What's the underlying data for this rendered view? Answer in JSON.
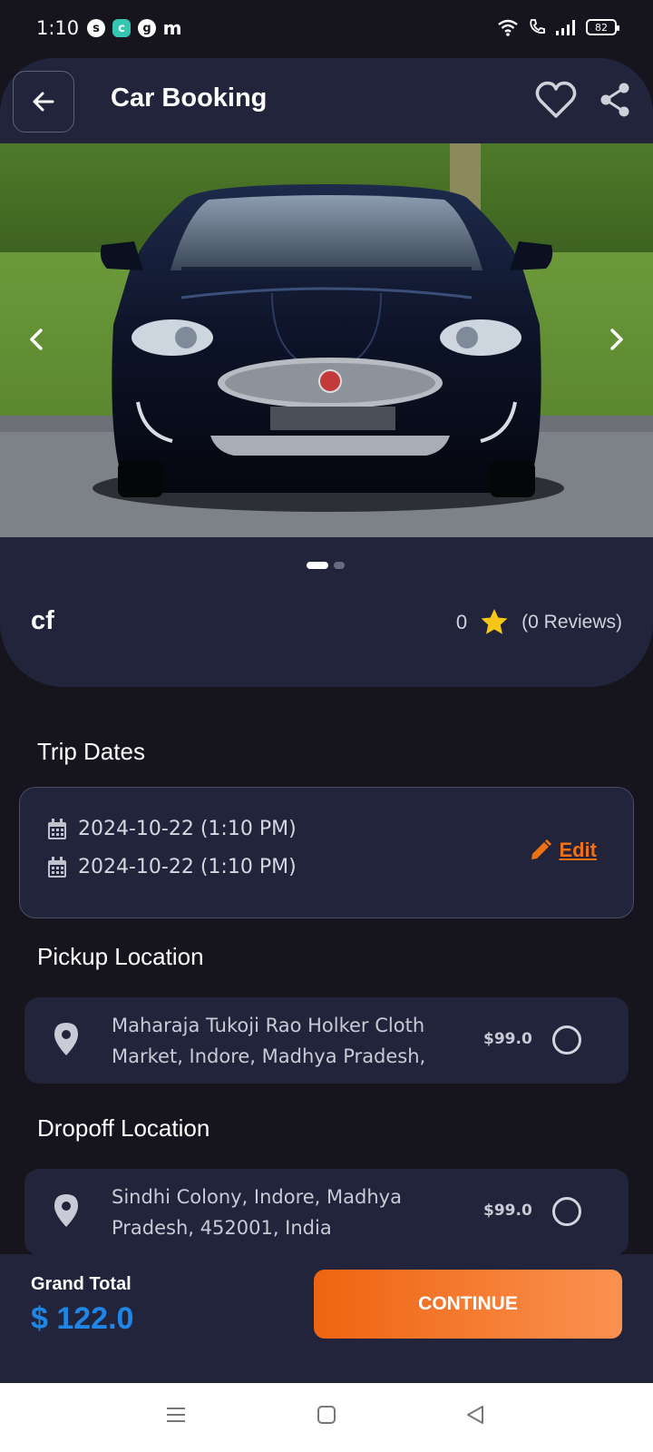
{
  "status_bar": {
    "time": "1:10",
    "app_icons": [
      "s",
      "c",
      "g",
      "m"
    ],
    "battery": "82"
  },
  "header": {
    "title": "Car Booking"
  },
  "gallery": {
    "slide_count": 2,
    "active_index": 0
  },
  "car": {
    "name": "cf",
    "rating": "0",
    "reviews": "(0 Reviews)"
  },
  "trip_dates": {
    "title": "Trip Dates",
    "start": "2024-10-22 (1:10 PM)",
    "end": "2024-10-22 (1:10 PM)",
    "edit_label": "Edit"
  },
  "pickup": {
    "title": "Pickup Location",
    "address": "Maharaja Tukoji Rao Holker Cloth Market, Indore, Madhya Pradesh,",
    "price": "$99.0"
  },
  "dropoff": {
    "title": "Dropoff Location",
    "address": "Sindhi Colony, Indore, Madhya Pradesh, 452001, India",
    "price": "$99.0"
  },
  "footer": {
    "grand_total_label": "Grand Total",
    "grand_total_value": "$ 122.0",
    "continue_label": "CONTINUE"
  },
  "colors": {
    "accent": "#f07014",
    "total": "#1f86e8",
    "card": "#21243a",
    "background": "#16141c",
    "star": "#f5c518"
  }
}
